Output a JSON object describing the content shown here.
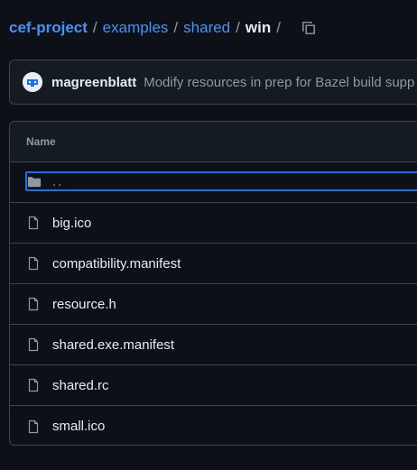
{
  "breadcrumb": {
    "root": "cef-project",
    "items": [
      "examples",
      "shared"
    ],
    "current": "win",
    "separator": "/",
    "copy_icon": "copy-icon"
  },
  "commit": {
    "author": "magreenblatt",
    "message": "Modify resources in prep for Bazel build supp",
    "avatar_icon": "avatar-icon"
  },
  "table": {
    "header": "Name",
    "parent": "..",
    "files": [
      {
        "name": "big.ico",
        "icon": "file-icon"
      },
      {
        "name": "compatibility.manifest",
        "icon": "file-icon"
      },
      {
        "name": "resource.h",
        "icon": "file-icon"
      },
      {
        "name": "shared.exe.manifest",
        "icon": "file-icon"
      },
      {
        "name": "shared.rc",
        "icon": "file-icon"
      },
      {
        "name": "small.ico",
        "icon": "file-icon"
      }
    ]
  },
  "colors": {
    "background": "#0d1117",
    "link": "#4493f8",
    "border": "#3d444d",
    "muted": "#9198a1",
    "focus": "#1f6feb"
  }
}
